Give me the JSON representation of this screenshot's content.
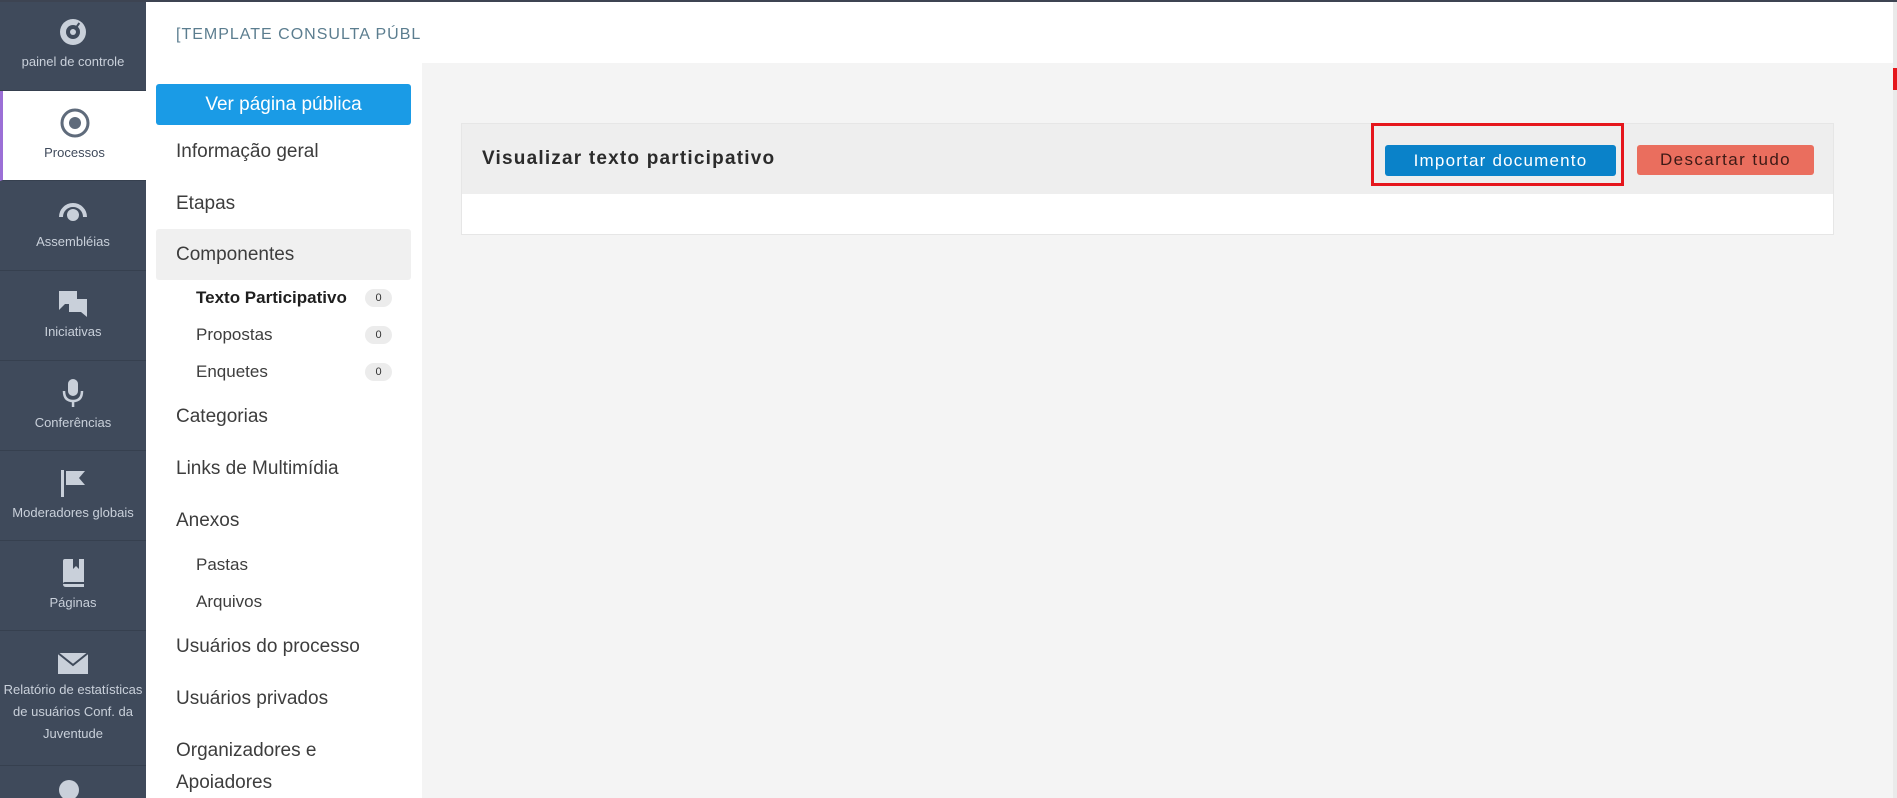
{
  "icon_nav": {
    "items": [
      {
        "label": "painel de controle",
        "icon": "dashboard-icon"
      },
      {
        "label": "Processos",
        "icon": "target-icon",
        "active": true
      },
      {
        "label": "Assembléias",
        "icon": "assemblies-icon"
      },
      {
        "label": "Iniciativas",
        "icon": "chat-bubbles-icon"
      },
      {
        "label": "Conferências",
        "icon": "microphone-icon"
      },
      {
        "label": "Moderadores globais",
        "icon": "flag-icon"
      },
      {
        "label": "Páginas",
        "icon": "book-icon"
      },
      {
        "label": "Relatório de estatísticas de usuários Conf. da Juventude",
        "icon": "envelope-icon"
      }
    ]
  },
  "space": {
    "title": "[TEMPLATE CONSULTA PÚBLICA]",
    "public_button": "Ver página pública"
  },
  "menu": {
    "info_geral": "Informação geral",
    "etapas": "Etapas",
    "componentes": "Componentes",
    "components": [
      {
        "label": "Texto Participativo",
        "count": "0"
      },
      {
        "label": "Propostas",
        "count": "0"
      },
      {
        "label": "Enquetes",
        "count": "0"
      }
    ],
    "categorias": "Categorias",
    "links_multimidia": "Links de Multimídia",
    "anexos": "Anexos",
    "attachments": [
      "Pastas",
      "Arquivos"
    ],
    "usuarios_processo": "Usuários do processo",
    "usuarios_privados": "Usuários privados",
    "organizadores": "Organizadores e Apoiadores"
  },
  "card": {
    "title": "Visualizar texto participativo",
    "import_button": "Importar documento",
    "discard_button": "Descartar tudo"
  },
  "colors": {
    "primary": "#1a9be6",
    "import": "#0a82c9",
    "discard": "#ea6e5e",
    "highlight": "#e5161c",
    "sidebar": "#3f4a5b"
  }
}
